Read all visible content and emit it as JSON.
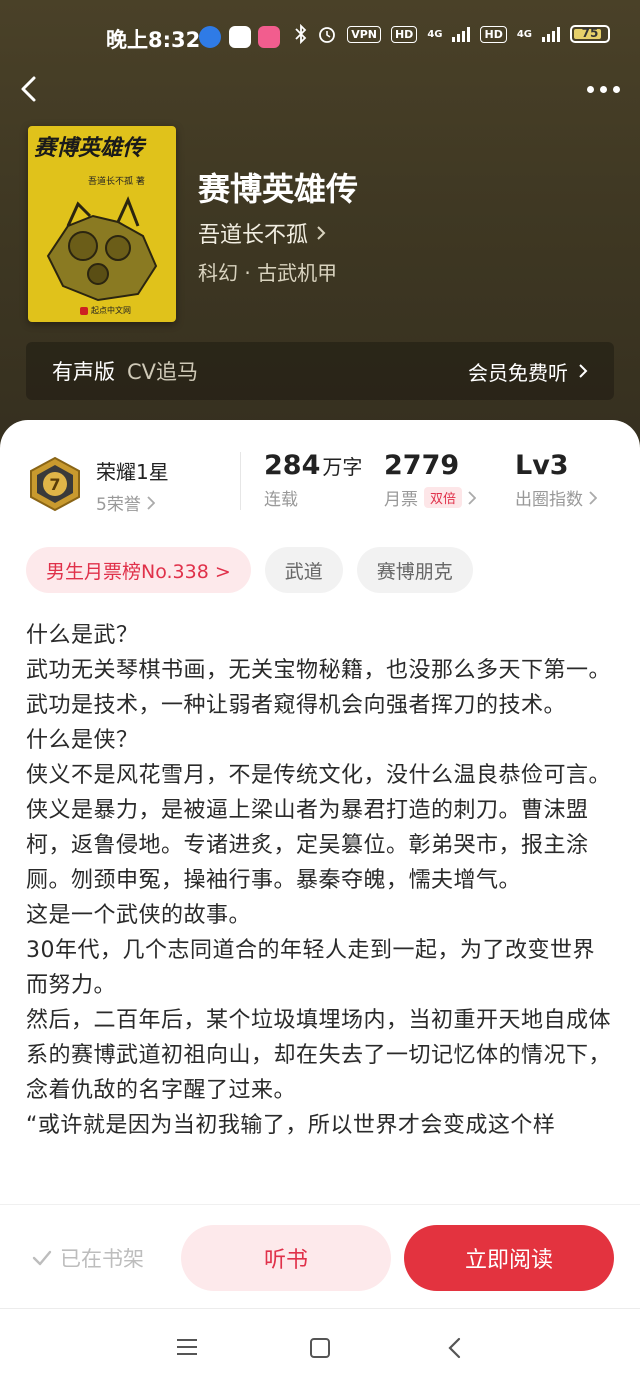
{
  "status_bar": {
    "time": "晚上8:32",
    "vpn": "VPN",
    "hd1": "HD",
    "net1": "4G",
    "hd2": "HD",
    "net2": "4G",
    "battery": "75"
  },
  "book": {
    "cover_title": "赛博英雄传",
    "cover_author": "吾道长不孤 著",
    "cover_publisher": "起点中文网",
    "title": "赛博英雄传",
    "author": "吾道长不孤",
    "genre": "科幻 · 古武机甲"
  },
  "audio": {
    "label": "有声版",
    "narrator": "CV追马",
    "cta": "会员免费听"
  },
  "honor": {
    "badge_level": "7",
    "title": "荣耀1星",
    "subtitle": "5荣誉"
  },
  "stats": [
    {
      "value": "284",
      "unit": "万字",
      "label": "连载"
    },
    {
      "value": "2779",
      "unit": "",
      "label": "月票",
      "badge": "双倍"
    },
    {
      "value": "Lv3",
      "unit": "",
      "label": "出圈指数"
    }
  ],
  "tags": [
    "男生月票榜No.338 >",
    "武道",
    "赛博朋克"
  ],
  "synopsis": [
    "什么是武？",
    "武功无关琴棋书画，无关宝物秘籍，也没那么多天下第一。武功是技术，一种让弱者窥得机会向强者挥刀的技术。",
    "什么是侠？",
    "侠义不是风花雪月，不是传统文化，没什么温良恭俭可言。侠义是暴力，是被逼上梁山者为暴君打造的刺刀。曹沫盟柯，返鲁侵地。专诸进炙，定吴篡位。彰弟哭市，报主涂厕。刎颈申冤，操袖行事。暴秦夺魄，懦夫增气。",
    "这是一个武侠的故事。",
    "30年代，几个志同道合的年轻人走到一起，为了改变世界而努力。",
    "然后，二百年后，某个垃圾填埋场内，当初重开天地自成体系的赛博武道初祖向山，却在失去了一切记忆体的情况下，念着仇敌的名字醒了过来。",
    "“或许就是因为当初我输了，所以世界才会变成这个样"
  ],
  "actions": {
    "shelf": "已在书架",
    "listen": "听书",
    "read": "立即阅读"
  },
  "colors": {
    "accent": "#e3333f",
    "hero_bg": "#3f3823"
  }
}
